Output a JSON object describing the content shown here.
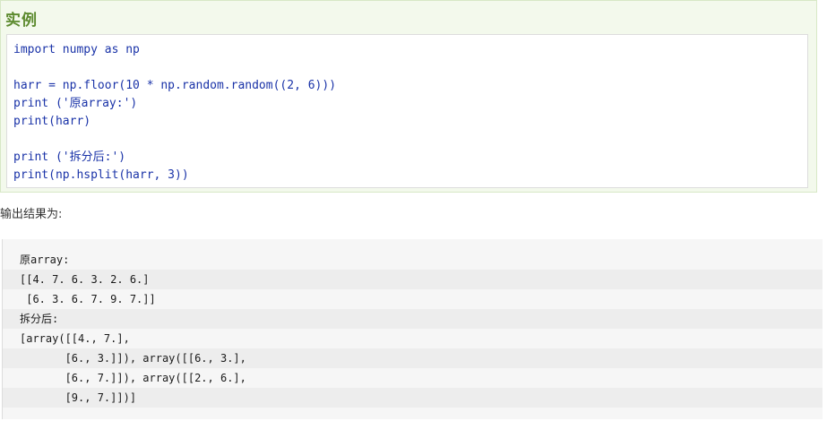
{
  "example": {
    "title": "实例",
    "code_lines": [
      "import numpy as np",
      "",
      "harr = np.floor(10 * np.random.random((2, 6)))",
      "print ('原array:')",
      "print(harr)",
      "",
      "print ('拆分后:')",
      "print(np.hsplit(harr, 3))"
    ]
  },
  "output": {
    "label": "输出结果为:",
    "lines": [
      "原array:",
      "[[4. 7. 6. 3. 2. 6.]",
      " [6. 3. 6. 7. 9. 7.]]",
      "拆分后:",
      "[array([[4., 7.],",
      "       [6., 3.]]), array([[6., 3.],",
      "       [6., 7.]]), array([[2., 6.],",
      "       [9., 7.]])]"
    ]
  }
}
